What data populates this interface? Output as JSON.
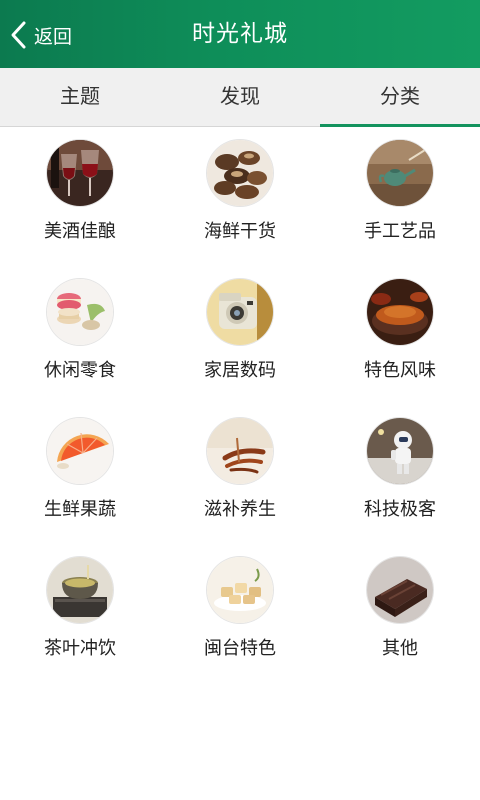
{
  "header": {
    "back_label": "返回",
    "title": "时光礼城"
  },
  "tabs": [
    {
      "label": "主题"
    },
    {
      "label": "发现"
    },
    {
      "label": "分类"
    }
  ],
  "categories": [
    {
      "label": "美酒佳酿",
      "icon": "wine-glasses-icon"
    },
    {
      "label": "海鲜干货",
      "icon": "dried-mushrooms-icon"
    },
    {
      "label": "手工艺品",
      "icon": "teapot-craft-icon"
    },
    {
      "label": "休闲零食",
      "icon": "macaron-dessert-icon"
    },
    {
      "label": "家居数码",
      "icon": "instant-camera-icon"
    },
    {
      "label": "特色风味",
      "icon": "spice-powder-icon"
    },
    {
      "label": "生鲜果蔬",
      "icon": "orange-slice-icon"
    },
    {
      "label": "滋补养生",
      "icon": "ginseng-root-icon"
    },
    {
      "label": "科技极客",
      "icon": "astronaut-figure-icon"
    },
    {
      "label": "茶叶冲饮",
      "icon": "tea-cup-icon"
    },
    {
      "label": "闽台特色",
      "icon": "pastry-snack-icon"
    },
    {
      "label": "其他",
      "icon": "chocolate-cake-icon"
    }
  ],
  "colors": {
    "header": "#0e8a57",
    "tab_indicator": "#13935e",
    "tab_bar": "#f0f0f0"
  }
}
